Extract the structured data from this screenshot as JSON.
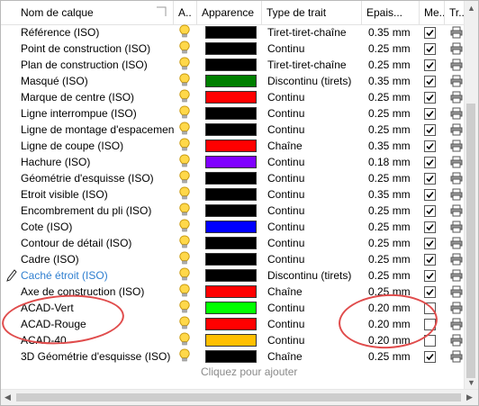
{
  "headers": {
    "name": "Nom de calque",
    "on": "A..",
    "color": "Apparence",
    "linetype": "Type de trait",
    "lineweight": "Epais...",
    "plot": "Me...",
    "print": "Tr..."
  },
  "rows": [
    {
      "name": "Référence (ISO)",
      "color": "#000000",
      "linetype": "Tiret-tiret-chaîne",
      "lineweight": "0.35 mm",
      "checked": true
    },
    {
      "name": "Point de construction (ISO)",
      "color": "#000000",
      "linetype": "Continu",
      "lineweight": "0.25 mm",
      "checked": true
    },
    {
      "name": "Plan de construction (ISO)",
      "color": "#000000",
      "linetype": "Tiret-tiret-chaîne",
      "lineweight": "0.25 mm",
      "checked": true
    },
    {
      "name": "Masqué (ISO)",
      "color": "#007f00",
      "linetype": "Discontinu (tirets)",
      "lineweight": "0.35 mm",
      "checked": true
    },
    {
      "name": "Marque de centre (ISO)",
      "color": "#ff0000",
      "linetype": "Continu",
      "lineweight": "0.25 mm",
      "checked": true
    },
    {
      "name": "Ligne interrompue (ISO)",
      "color": "#000000",
      "linetype": "Continu",
      "lineweight": "0.25 mm",
      "checked": true
    },
    {
      "name": "Ligne de montage d'espacement (IS",
      "color": "#000000",
      "linetype": "Continu",
      "lineweight": "0.25 mm",
      "checked": true
    },
    {
      "name": "Ligne de coupe (ISO)",
      "color": "#ff0000",
      "linetype": "Chaîne",
      "lineweight": "0.35 mm",
      "checked": true
    },
    {
      "name": "Hachure (ISO)",
      "color": "#7f00ff",
      "linetype": "Continu",
      "lineweight": "0.18 mm",
      "checked": true
    },
    {
      "name": "Géométrie d'esquisse (ISO)",
      "color": "#000000",
      "linetype": "Continu",
      "lineweight": "0.25 mm",
      "checked": true
    },
    {
      "name": "Etroit visible (ISO)",
      "color": "#000000",
      "linetype": "Continu",
      "lineweight": "0.35 mm",
      "checked": true
    },
    {
      "name": "Encombrement du pli (ISO)",
      "color": "#000000",
      "linetype": "Continu",
      "lineweight": "0.25 mm",
      "checked": true
    },
    {
      "name": "Cote (ISO)",
      "color": "#0000ff",
      "linetype": "Continu",
      "lineweight": "0.25 mm",
      "checked": true
    },
    {
      "name": "Contour de détail (ISO)",
      "color": "#000000",
      "linetype": "Continu",
      "lineweight": "0.25 mm",
      "checked": true
    },
    {
      "name": "Cadre (ISO)",
      "color": "#000000",
      "linetype": "Continu",
      "lineweight": "0.25 mm",
      "checked": true
    },
    {
      "name": "Caché étroit (ISO)",
      "color": "#000000",
      "linetype": "Discontinu (tirets)",
      "lineweight": "0.25 mm",
      "checked": true,
      "active": true
    },
    {
      "name": "Axe de construction (ISO)",
      "color": "#ff0000",
      "linetype": "Chaîne",
      "lineweight": "0.25 mm",
      "checked": true
    },
    {
      "name": "ACAD-Vert",
      "color": "#00ff00",
      "linetype": "Continu",
      "lineweight": "0.20 mm",
      "checked": false
    },
    {
      "name": "ACAD-Rouge",
      "color": "#ff0000",
      "linetype": "Continu",
      "lineweight": "0.20 mm",
      "checked": false
    },
    {
      "name": "ACAD-40",
      "color": "#ffbf00",
      "linetype": "Continu",
      "lineweight": "0.20 mm",
      "checked": false
    },
    {
      "name": "3D Géométrie d'esquisse (ISO)",
      "color": "#000000",
      "linetype": "Chaîne",
      "lineweight": "0.25 mm",
      "checked": true
    }
  ],
  "add_row_label": "Cliquez pour ajouter",
  "icons": {
    "on": "lightbulb-icon",
    "print": "printer-icon",
    "active": "pencil-icon"
  },
  "annotation_color": "#e04c4c"
}
